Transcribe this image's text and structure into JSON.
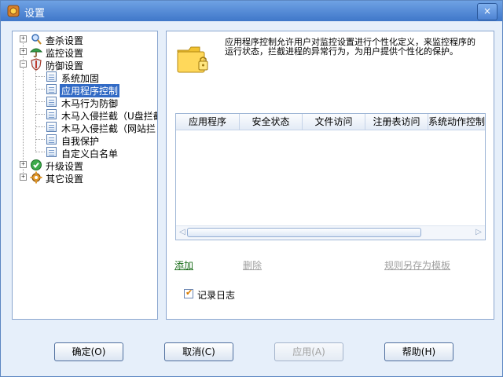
{
  "window": {
    "title": "设置",
    "close_label": "×"
  },
  "tree": {
    "items": [
      {
        "label": "查杀设置",
        "icon": "magnifier-icon",
        "expander": "+"
      },
      {
        "label": "监控设置",
        "icon": "umbrella-icon",
        "expander": "+"
      },
      {
        "label": "防御设置",
        "icon": "shield-icon",
        "expander": "−"
      },
      {
        "label": "系统加固",
        "icon": "document-icon"
      },
      {
        "label": "应用程序控制",
        "icon": "document-icon",
        "selected": true
      },
      {
        "label": "木马行为防御",
        "icon": "document-icon"
      },
      {
        "label": "木马入侵拦截（U盘拦截",
        "icon": "document-icon"
      },
      {
        "label": "木马入侵拦截（网站拦",
        "icon": "document-icon"
      },
      {
        "label": "自我保护",
        "icon": "document-icon"
      },
      {
        "label": "自定义白名单",
        "icon": "document-icon"
      },
      {
        "label": "升级设置",
        "icon": "checkmark-circle-icon",
        "expander": "+"
      },
      {
        "label": "其它设置",
        "icon": "gear-icon",
        "expander": "+"
      }
    ]
  },
  "panel": {
    "description": "应用程序控制允许用户对监控设置进行个性化定义，来监控程序的运行状态，拦截进程的异常行为，为用户提供个性化的保护。",
    "columns": [
      "应用程序",
      "安全状态",
      "文件访问",
      "注册表访问",
      "系统动作控制"
    ],
    "add_label": "添加",
    "delete_label": "删除",
    "save_template_label": "规则另存为模板",
    "log_label": "记录日志",
    "log_checked": true
  },
  "buttons": {
    "ok": "确定(O)",
    "cancel": "取消(C)",
    "apply": "应用(A)",
    "help": "帮助(H)"
  },
  "colors": {
    "accent": "#316ac5",
    "link_active": "#1c6e1c",
    "title_bar": "#3f77c9"
  }
}
